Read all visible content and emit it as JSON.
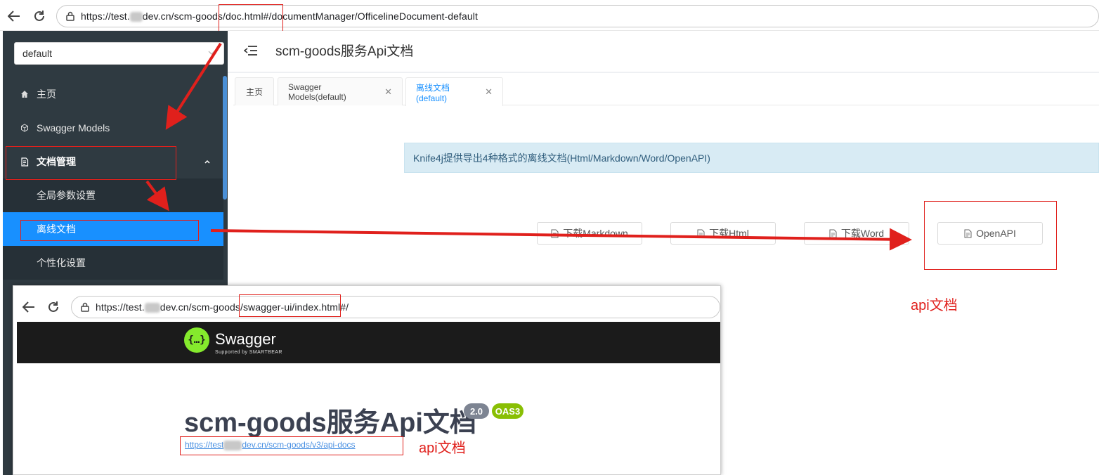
{
  "browser_top": {
    "url_prefix": "https://test.",
    "url_main": "dev.cn/scm-goods/doc.html#/documentManager/OfficelineDocument-default"
  },
  "sidebar": {
    "group_select": "default",
    "items": [
      {
        "label": "主页",
        "icon": "home-icon"
      },
      {
        "label": "Swagger Models",
        "icon": "cube-icon"
      },
      {
        "label": "文档管理",
        "icon": "document-icon"
      },
      {
        "label": "全局参数设置"
      },
      {
        "label": "离线文档"
      },
      {
        "label": "个性化设置"
      }
    ]
  },
  "header": {
    "title": "scm-goods服务Api文档"
  },
  "tabs": [
    {
      "label": "主页"
    },
    {
      "label": "Swagger Models(default)"
    },
    {
      "label": "离线文档(default)"
    }
  ],
  "alert": {
    "text": "Knife4j提供导出4种格式的离线文档(Html/Markdown/Word/OpenAPI)"
  },
  "downloads": [
    {
      "label": "下载Markdown"
    },
    {
      "label": "下载Html"
    },
    {
      "label": "下载Word"
    },
    {
      "label": "OpenAPI"
    }
  ],
  "annotation_api_doc_1": "api文档",
  "annotation_api_doc_2": "api文档",
  "inset": {
    "url_prefix": "https://test.",
    "url_main": "dev.cn/scm-goods/swagger-ui/index.html#/",
    "brand": "Swagger",
    "brand_sub": "Supported by SMARTBEAR",
    "title": "scm-goods服务Api文档",
    "version_badge": "2.0",
    "oas_badge": "OAS3",
    "link_prefix": "https://test",
    "link_main": "dev.cn/scm-goods/v3/api-docs"
  },
  "colors": {
    "accent": "#1890ff",
    "sidebar": "#2f3a41",
    "annotation": "#e0201c",
    "swagger_green": "#49cc90"
  }
}
